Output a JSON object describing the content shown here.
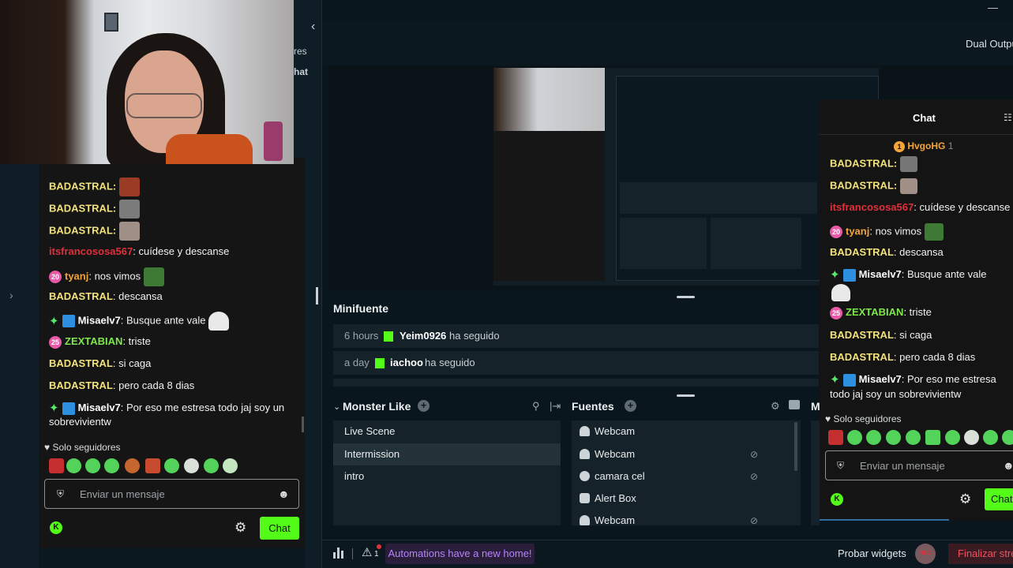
{
  "left_sidebar": {
    "fragment_top": "res",
    "fragment_bottom": "hat"
  },
  "left_chat": {
    "messages": [
      {
        "user": "BADASTRAL",
        "text": "",
        "user_color": "yellow",
        "emote_color": "#9a3b25"
      },
      {
        "user": "BADASTRAL",
        "text": "",
        "user_color": "yellow",
        "emote_color": "#7b7b7b"
      },
      {
        "user": "BADASTRAL",
        "text": "",
        "user_color": "yellow",
        "emote_color": "#a08f86"
      },
      {
        "user": "itsfrancososa567",
        "text": ": cuídese y descanse",
        "user_color": "red"
      },
      {
        "user": "tyanj",
        "text": ": nos vimos",
        "user_color": "orange",
        "badge": "20"
      },
      {
        "user": "BADASTRAL",
        "text": ": descansa",
        "user_color": "yellow"
      },
      {
        "user": "Misaelv7",
        "text": ": Busque ante vale",
        "user_color": "white"
      },
      {
        "user": "ZEXTABIAN",
        "text": ": triste",
        "user_color": "green",
        "badge": "25"
      },
      {
        "user": "BADASTRAL",
        "text": ": si caga",
        "user_color": "yellow"
      },
      {
        "user": "BADASTRAL",
        "text": ": pero cada 8 dias",
        "user_color": "yellow"
      },
      {
        "user": "Misaelv7",
        "text": ": Por eso me estresa todo jaj soy un sobrevivientw",
        "user_color": "white"
      }
    ],
    "followers_only": "Solo seguidores",
    "input_placeholder": "Enviar un mensaje",
    "send_label": "Chat"
  },
  "topbar": {
    "dual_output": "Dual Output"
  },
  "minifuente": {
    "title": "Minifuente",
    "events": [
      {
        "when": "6 hours",
        "user": "Yeim0926",
        "action": "ha seguido"
      },
      {
        "when": "a day",
        "user": "iachoo",
        "action": "ha seguido"
      }
    ]
  },
  "scenes": {
    "title": "Monster Like",
    "items": [
      "Live Scene",
      "Intermission",
      "intro"
    ],
    "selected": "Intermission"
  },
  "sources": {
    "title": "Fuentes",
    "items": [
      "Webcam",
      "Webcam",
      "camara cel",
      "Alert Box",
      "Webcam"
    ]
  },
  "mixer_fragment": "M",
  "right_chat": {
    "title": "Chat",
    "top_user": "HvgoHG",
    "top_user_count": "1",
    "messages": [
      {
        "user": "BADASTRAL",
        "text": ":",
        "user_color": "yellow"
      },
      {
        "user": "BADASTRAL",
        "text": ":",
        "user_color": "yellow"
      },
      {
        "user": "itsfrancososa567",
        "text": ": cuídese y descanse",
        "user_color": "red"
      },
      {
        "user": "tyanj",
        "text": ": nos vimos",
        "user_color": "orange",
        "badge": "20"
      },
      {
        "user": "BADASTRAL",
        "text": ": descansa",
        "user_color": "yellow"
      },
      {
        "user": "Misaelv7",
        "text": ": Busque ante vale",
        "user_color": "white"
      },
      {
        "user": "ZEXTABIAN",
        "text": ": triste",
        "user_color": "green",
        "badge": "25"
      },
      {
        "user": "BADASTRAL",
        "text": ": si caga",
        "user_color": "yellow"
      },
      {
        "user": "BADASTRAL",
        "text": ": pero cada 8 dias",
        "user_color": "yellow"
      },
      {
        "user": "Misaelv7",
        "text": ": Por eso me estresa",
        "text2": "todo jaj soy un sobrevivientw",
        "user_color": "white"
      }
    ],
    "followers_only": "Solo seguidores",
    "input_placeholder": "Enviar un mensaje",
    "send_label": "Chat"
  },
  "bottom_bar": {
    "automation": "Automations have a new home!",
    "alert_count": "1",
    "test_widgets": "Probar widgets",
    "rec": "REC",
    "end_stream": "Finalizar strea"
  },
  "colors": {
    "kick_green": "#53fc18",
    "panel": "#152229",
    "bg": "#09161d"
  }
}
